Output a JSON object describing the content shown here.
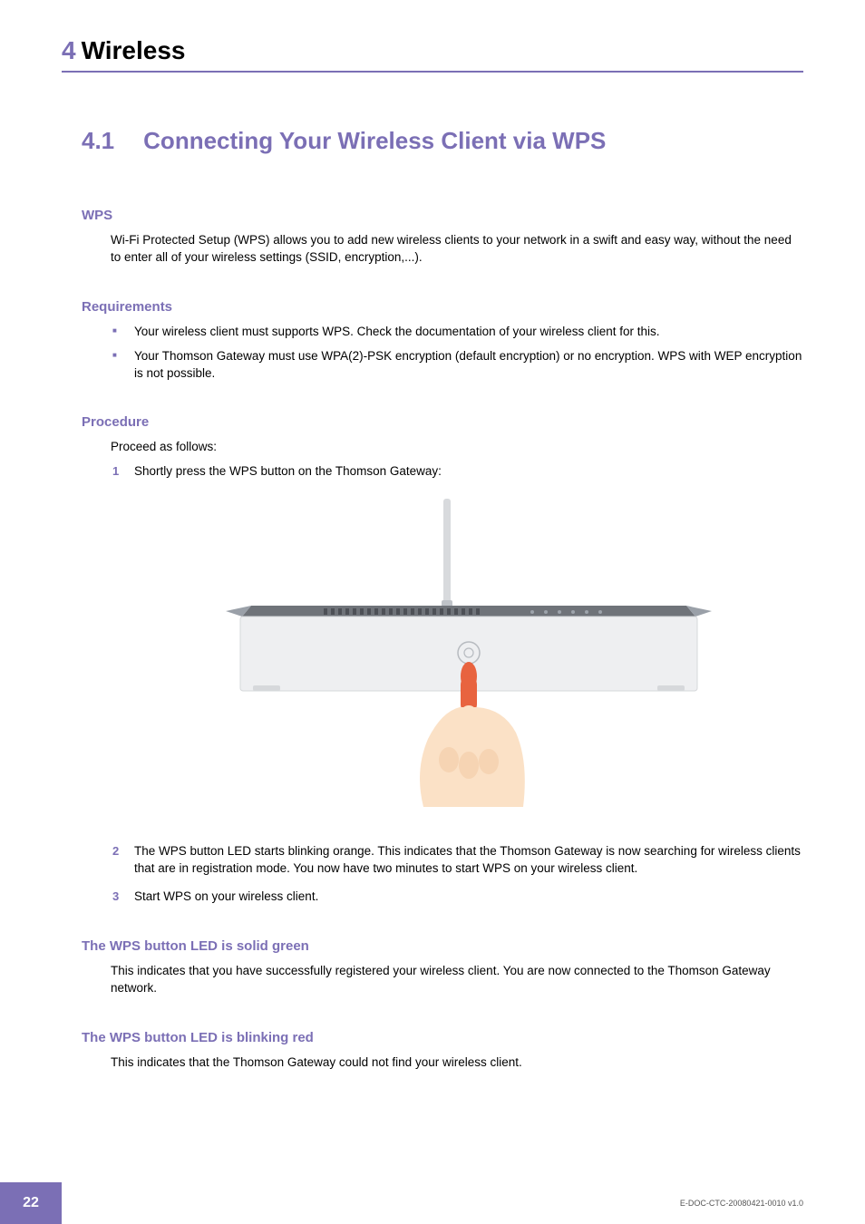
{
  "chapter": {
    "number": "4",
    "title": "Wireless"
  },
  "section": {
    "number": "4.1",
    "title": "Connecting Your Wireless Client via WPS"
  },
  "wps": {
    "heading": "WPS",
    "text": "Wi-Fi Protected Setup (WPS) allows you to add new wireless clients to your network in a swift and easy way, without the need to enter all of your wireless settings (SSID, encryption,...)."
  },
  "requirements": {
    "heading": "Requirements",
    "items": [
      "Your wireless client must supports WPS. Check the documentation of your wireless client for this.",
      "Your Thomson Gateway must use WPA(2)-PSK encryption (default encryption) or no encryption. WPS with WEP encryption is not possible."
    ]
  },
  "procedure": {
    "heading": "Procedure",
    "intro": "Proceed as follows:",
    "steps": [
      "Shortly press the WPS button on the Thomson Gateway:",
      "The WPS button LED starts blinking orange. This indicates that the Thomson Gateway is now searching for wireless clients that are in registration mode. You now have two minutes to start WPS on your wireless client.",
      "Start WPS on your wireless client."
    ]
  },
  "green": {
    "heading": "The WPS button LED is solid green",
    "text": "This indicates that you have successfully registered your wireless client. You are now connected to the Thomson Gateway network."
  },
  "red": {
    "heading": "The WPS button LED is blinking red",
    "text": "This indicates that the Thomson Gateway could not find your wireless client."
  },
  "footer": {
    "page": "22",
    "docid": "E-DOC-CTC-20080421-0010 v1.0"
  }
}
